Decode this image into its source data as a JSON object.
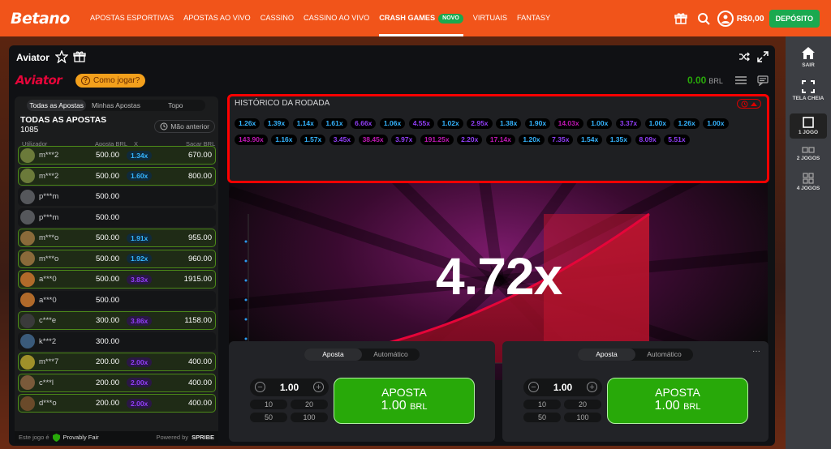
{
  "brand": "Betano",
  "nav": [
    {
      "label": "APOSTAS ESPORTIVAS",
      "active": false
    },
    {
      "label": "APOSTAS AO VIVO",
      "active": false
    },
    {
      "label": "CASSINO",
      "active": false
    },
    {
      "label": "CASSINO AO VIVO",
      "active": false
    },
    {
      "label": "CRASH GAMES",
      "active": true,
      "badge": "NOVO"
    },
    {
      "label": "VIRTUAIS",
      "active": false
    },
    {
      "label": "FANTASY",
      "active": false
    }
  ],
  "account": {
    "balance": "R$0,00",
    "deposit_label": "DEPÓSITO"
  },
  "rail": [
    {
      "label": "SAIR",
      "icon": "home-icon"
    },
    {
      "label": "TELA CHEIA",
      "icon": "fullscreen-icon"
    },
    {
      "label": "1 JOGO",
      "icon": "one-game-icon"
    },
    {
      "label": "2 JOGOS",
      "icon": "two-games-icon"
    },
    {
      "label": "4 JOGOS",
      "icon": "four-games-icon"
    }
  ],
  "game": {
    "title": "Aviator",
    "logo": "Aviator",
    "how_to": "Como jogar?",
    "balance": "0.00",
    "currency": "BRL",
    "multiplier": "4.72x"
  },
  "bets_panel": {
    "tabs": [
      "Todas as Apostas",
      "Minhas Apostas",
      "Topo"
    ],
    "title": "TODAS AS APOSTAS",
    "count": "1085",
    "prev_label": "Mão anterior",
    "columns": {
      "user": "Utilizador",
      "bet": "Aposta BRL",
      "x": "X",
      "cashout": "Sacar BRL"
    },
    "rows": [
      {
        "user": "m***2",
        "bet": "500.00",
        "mult": "1.34x",
        "cashout": "670.00",
        "win": true,
        "tone": "blue"
      },
      {
        "user": "m***2",
        "bet": "500.00",
        "mult": "1.60x",
        "cashout": "800.00",
        "win": true,
        "tone": "blue"
      },
      {
        "user": "p***m",
        "bet": "500.00",
        "mult": "",
        "cashout": "",
        "win": false,
        "tone": ""
      },
      {
        "user": "p***m",
        "bet": "500.00",
        "mult": "",
        "cashout": "",
        "win": false,
        "tone": ""
      },
      {
        "user": "m***o",
        "bet": "500.00",
        "mult": "1.91x",
        "cashout": "955.00",
        "win": true,
        "tone": "blue"
      },
      {
        "user": "m***o",
        "bet": "500.00",
        "mult": "1.92x",
        "cashout": "960.00",
        "win": true,
        "tone": "blue"
      },
      {
        "user": "a***0",
        "bet": "500.00",
        "mult": "3.83x",
        "cashout": "1915.00",
        "win": true,
        "tone": "purple"
      },
      {
        "user": "a***0",
        "bet": "500.00",
        "mult": "",
        "cashout": "",
        "win": false,
        "tone": ""
      },
      {
        "user": "c***e",
        "bet": "300.00",
        "mult": "3.86x",
        "cashout": "1158.00",
        "win": true,
        "tone": "purple"
      },
      {
        "user": "k***2",
        "bet": "300.00",
        "mult": "",
        "cashout": "",
        "win": false,
        "tone": ""
      },
      {
        "user": "m***7",
        "bet": "200.00",
        "mult": "2.00x",
        "cashout": "400.00",
        "win": true,
        "tone": "purple"
      },
      {
        "user": "c***l",
        "bet": "200.00",
        "mult": "2.00x",
        "cashout": "400.00",
        "win": true,
        "tone": "purple"
      },
      {
        "user": "d***o",
        "bet": "200.00",
        "mult": "2.00x",
        "cashout": "400.00",
        "win": true,
        "tone": "purple"
      }
    ],
    "footer": {
      "left": "Este jogo é",
      "provably": "Provably Fair",
      "powered": "Powered by",
      "spribe": "SPRIBE"
    }
  },
  "history": {
    "title": "HISTÓRICO DA RODADA",
    "values": [
      {
        "v": "1.26x",
        "tone": "blue"
      },
      {
        "v": "1.39x",
        "tone": "blue"
      },
      {
        "v": "1.14x",
        "tone": "blue"
      },
      {
        "v": "1.61x",
        "tone": "blue"
      },
      {
        "v": "6.66x",
        "tone": "purple"
      },
      {
        "v": "1.06x",
        "tone": "blue"
      },
      {
        "v": "4.55x",
        "tone": "purple"
      },
      {
        "v": "1.02x",
        "tone": "blue"
      },
      {
        "v": "2.95x",
        "tone": "purple"
      },
      {
        "v": "1.38x",
        "tone": "blue"
      },
      {
        "v": "1.90x",
        "tone": "blue"
      },
      {
        "v": "14.03x",
        "tone": "pink"
      },
      {
        "v": "1.00x",
        "tone": "blue"
      },
      {
        "v": "3.37x",
        "tone": "purple"
      },
      {
        "v": "1.00x",
        "tone": "blue"
      },
      {
        "v": "1.26x",
        "tone": "blue"
      },
      {
        "v": "1.00x",
        "tone": "blue"
      },
      {
        "v": "143.90x",
        "tone": "pink"
      },
      {
        "v": "1.16x",
        "tone": "blue"
      },
      {
        "v": "1.57x",
        "tone": "blue"
      },
      {
        "v": "3.45x",
        "tone": "purple"
      },
      {
        "v": "38.45x",
        "tone": "pink"
      },
      {
        "v": "3.97x",
        "tone": "purple"
      },
      {
        "v": "191.25x",
        "tone": "pink"
      },
      {
        "v": "2.20x",
        "tone": "purple"
      },
      {
        "v": "17.14x",
        "tone": "pink"
      },
      {
        "v": "1.20x",
        "tone": "blue"
      },
      {
        "v": "7.35x",
        "tone": "purple"
      },
      {
        "v": "1.54x",
        "tone": "blue"
      },
      {
        "v": "1.35x",
        "tone": "blue"
      },
      {
        "v": "8.09x",
        "tone": "purple"
      },
      {
        "v": "5.51x",
        "tone": "purple"
      }
    ]
  },
  "bet_cards": [
    {
      "tabs": [
        "Aposta",
        "Automático"
      ],
      "amount": "1.00",
      "quick": [
        "10",
        "20",
        "50",
        "100"
      ],
      "button_label": "APOSTA",
      "button_amount": "1.00",
      "button_currency": "BRL"
    },
    {
      "tabs": [
        "Aposta",
        "Automático"
      ],
      "amount": "1.00",
      "quick": [
        "10",
        "20",
        "50",
        "100"
      ],
      "button_label": "APOSTA",
      "button_amount": "1.00",
      "button_currency": "BRL",
      "more": "···"
    }
  ],
  "colors": {
    "brand": "#f1541a",
    "green": "#28a909",
    "blue_mult": "#34b4ff",
    "purple_mult": "#913ef8",
    "pink_mult": "#c017b4",
    "highlight": "#ff0000"
  }
}
